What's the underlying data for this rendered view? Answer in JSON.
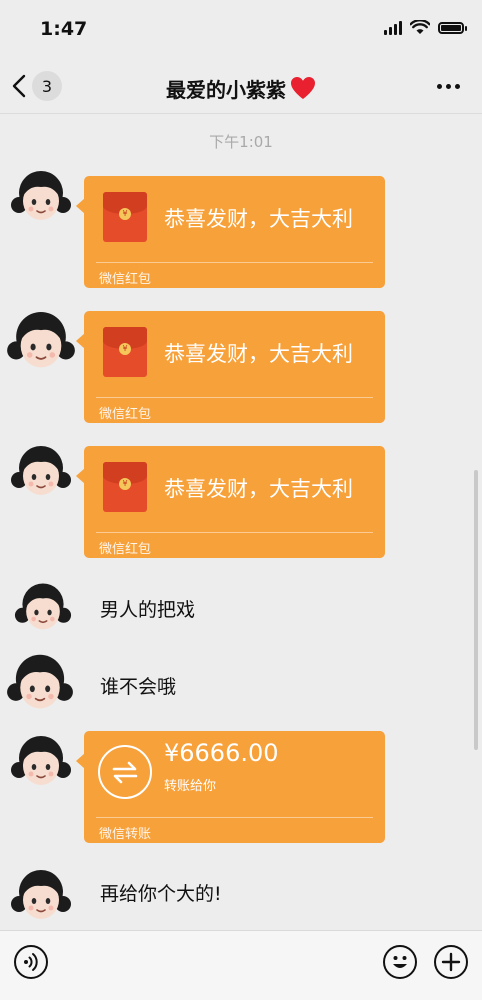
{
  "status": {
    "time": "1:47"
  },
  "nav": {
    "unread_count": "3",
    "title": "最爱的小紫紫"
  },
  "chat": {
    "timestamp": "下午1:01",
    "red_packets": [
      {
        "greeting": "恭喜发财，大吉大利",
        "footer": "微信红包"
      },
      {
        "greeting": "恭喜发财，大吉大利",
        "footer": "微信红包"
      },
      {
        "greeting": "恭喜发财，大吉大利",
        "footer": "微信红包"
      }
    ],
    "texts": [
      "男人的把戏",
      "谁不会哦"
    ],
    "transfer": {
      "amount": "¥6666.00",
      "label": "转账给你",
      "footer": "微信转账"
    },
    "last_text": "再给你个大的!"
  },
  "colors": {
    "card": "#f7a13b",
    "background": "#ededed",
    "envelope": "#e44c2a"
  },
  "icons": [
    "back-arrow-icon",
    "heart-icon",
    "more-dots-icon",
    "red-envelope-icon",
    "transfer-icon",
    "voice-icon",
    "emoji-icon",
    "plus-icon"
  ]
}
